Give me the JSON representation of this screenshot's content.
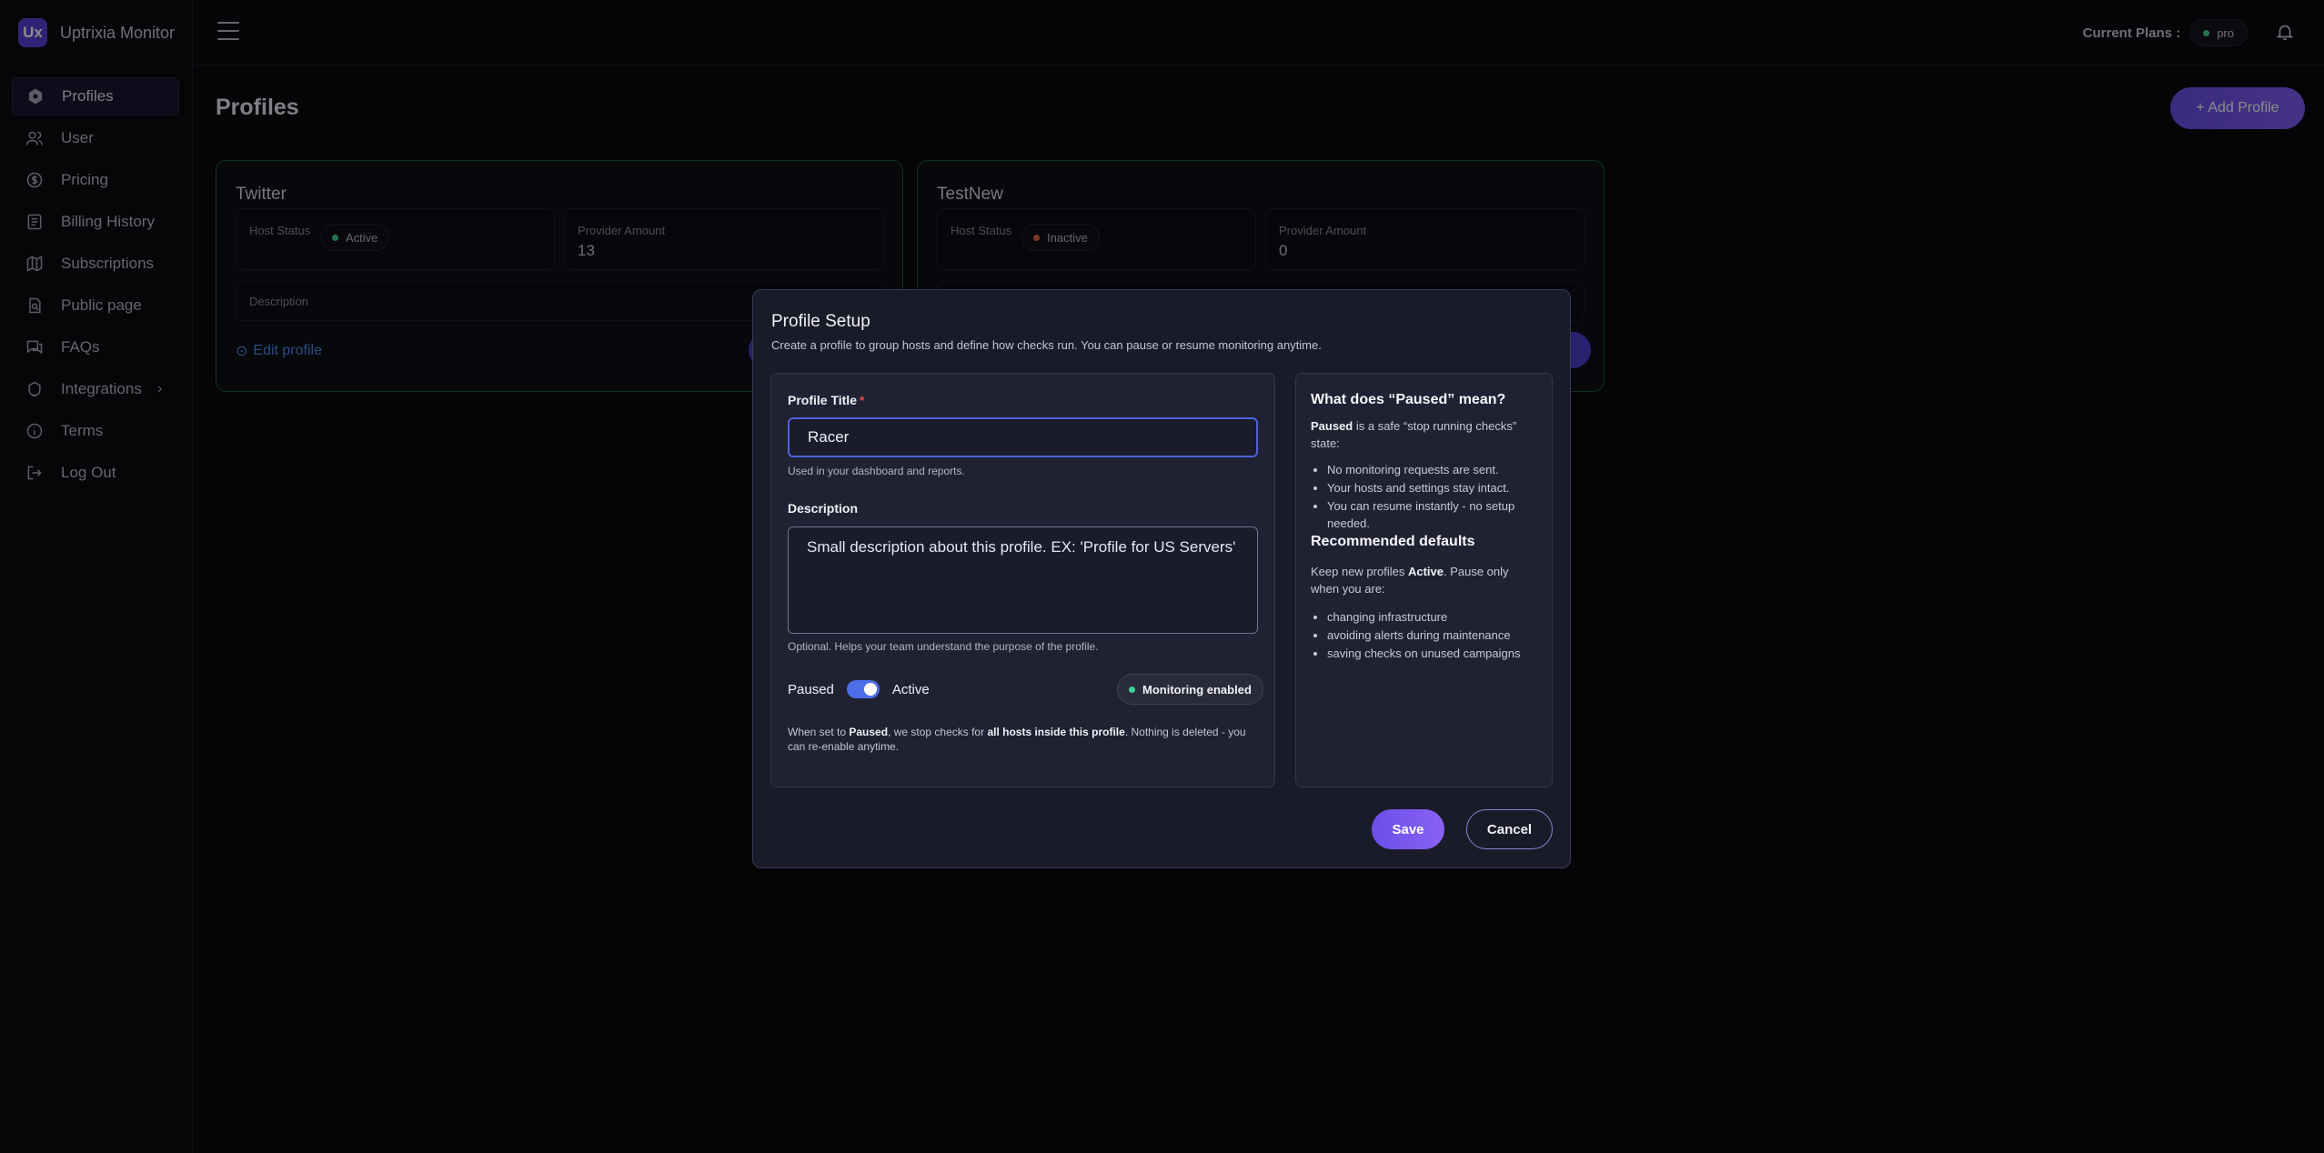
{
  "brand": {
    "logo_text": "Ux",
    "name": "Uptrixia Monitor"
  },
  "sidebar": {
    "items": [
      {
        "label": "Profiles",
        "icon": "hexagon-icon",
        "active": true
      },
      {
        "label": "User",
        "icon": "users-icon"
      },
      {
        "label": "Pricing",
        "icon": "dollar-circle-icon"
      },
      {
        "label": "Billing History",
        "icon": "receipt-icon"
      },
      {
        "label": "Subscriptions",
        "icon": "map-icon"
      },
      {
        "label": "Public page",
        "icon": "public-page-icon"
      },
      {
        "label": "FAQs",
        "icon": "chat-icon"
      },
      {
        "label": "Integrations",
        "icon": "integrations-icon",
        "has_chevron": true
      },
      {
        "label": "Terms",
        "icon": "info-icon"
      },
      {
        "label": "Log Out",
        "icon": "logout-icon"
      }
    ]
  },
  "header": {
    "plan_label": "Current Plans :",
    "plan_value": "pro"
  },
  "main": {
    "title": "Profiles",
    "add_button": "+ Add Profile",
    "cards": [
      {
        "title": "Twitter",
        "host_status_label": "Host Status",
        "host_status": "Active",
        "provider_label": "Provider Amount",
        "provider_amount": "13",
        "description_label": "Description",
        "edit_label": "Edit profile"
      },
      {
        "title": "TestNew",
        "host_status_label": "Host Status",
        "host_status": "Inactive",
        "provider_label": "Provider Amount",
        "provider_amount": "0"
      }
    ]
  },
  "modal": {
    "title": "Profile Setup",
    "subtitle": "Create a profile to group hosts and define how checks run. You can pause or resume monitoring anytime.",
    "title_label": "Profile Title",
    "title_value": "Racer",
    "title_help": "Used in your dashboard and reports.",
    "description_label": "Description",
    "description_placeholder": "Small description about this profile. EX: 'Profile for US Servers'",
    "description_help": "Optional. Helps your team understand the purpose of the profile.",
    "toggle_off_label": "Paused",
    "toggle_on_label": "Active",
    "monitoring_badge": "Monitoring enabled",
    "note_pre": "When set to ",
    "note_paused": "Paused",
    "note_mid": ", we stop checks for ",
    "note_hosts": "all hosts inside this profile",
    "note_post": ". Nothing is deleted - you can re-enable anytime.",
    "save": "Save",
    "cancel": "Cancel",
    "info": {
      "heading1": "What does “Paused” mean?",
      "p1_bold": "Paused",
      "p1_rest": " is a safe “stop running checks” state:",
      "list1": [
        "No monitoring requests are sent.",
        "Your hosts and settings stay intact.",
        "You can resume instantly - no setup needed."
      ],
      "heading2": "Recommended defaults",
      "p2_pre": "Keep new profiles ",
      "p2_bold": "Active",
      "p2_post": ". Pause only when you are:",
      "list2": [
        "changing infrastructure",
        "avoiding alerts during maintenance",
        "saving checks on unused campaigns"
      ]
    }
  }
}
